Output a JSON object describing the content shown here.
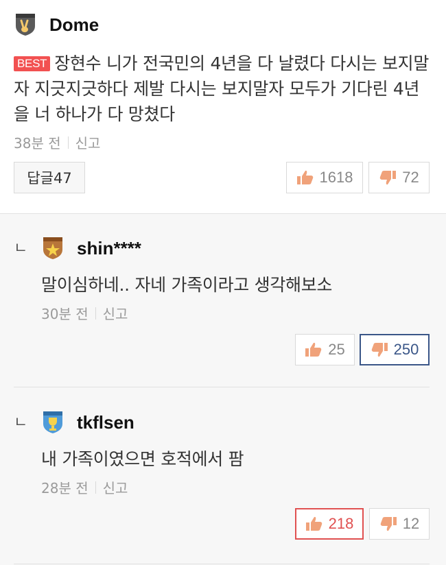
{
  "main": {
    "username": "Dome",
    "best_label": "BEST",
    "text": "장현수 니가 전국민의 4년을 다 날렸다 다시는 보지말자 지긋지긋하다 제발 다시는 보지말자 모두가 기다린 4년을 너 하나가 다 망쳤다",
    "time": "38분 전",
    "report": "신고",
    "reply_button": "답글47",
    "likes": "1618",
    "dislikes": "72"
  },
  "replies": [
    {
      "arrow": "ㄴ",
      "username": "shin****",
      "text": "말이심하네.. 자네 가족이라고 생각해보소",
      "time": "30분 전",
      "report": "신고",
      "likes": "25",
      "dislikes": "250"
    },
    {
      "arrow": "ㄴ",
      "username": "tkflsen",
      "text": "내 가족이였으면 호적에서 팜",
      "time": "28분 전",
      "report": "신고",
      "likes": "218",
      "dislikes": "12"
    }
  ],
  "colors": {
    "best_red": "#f25151",
    "like_active": "#e05050",
    "dislike_active": "#3a5688",
    "thumb_fill": "#f0a27a"
  },
  "icons": {
    "like": "thumbs-up-icon",
    "dislike": "thumbs-down-icon",
    "badge_main": "victory-hand-badge-icon",
    "badge_shin": "star-badge-icon",
    "badge_tkflsen": "trophy-badge-icon"
  }
}
